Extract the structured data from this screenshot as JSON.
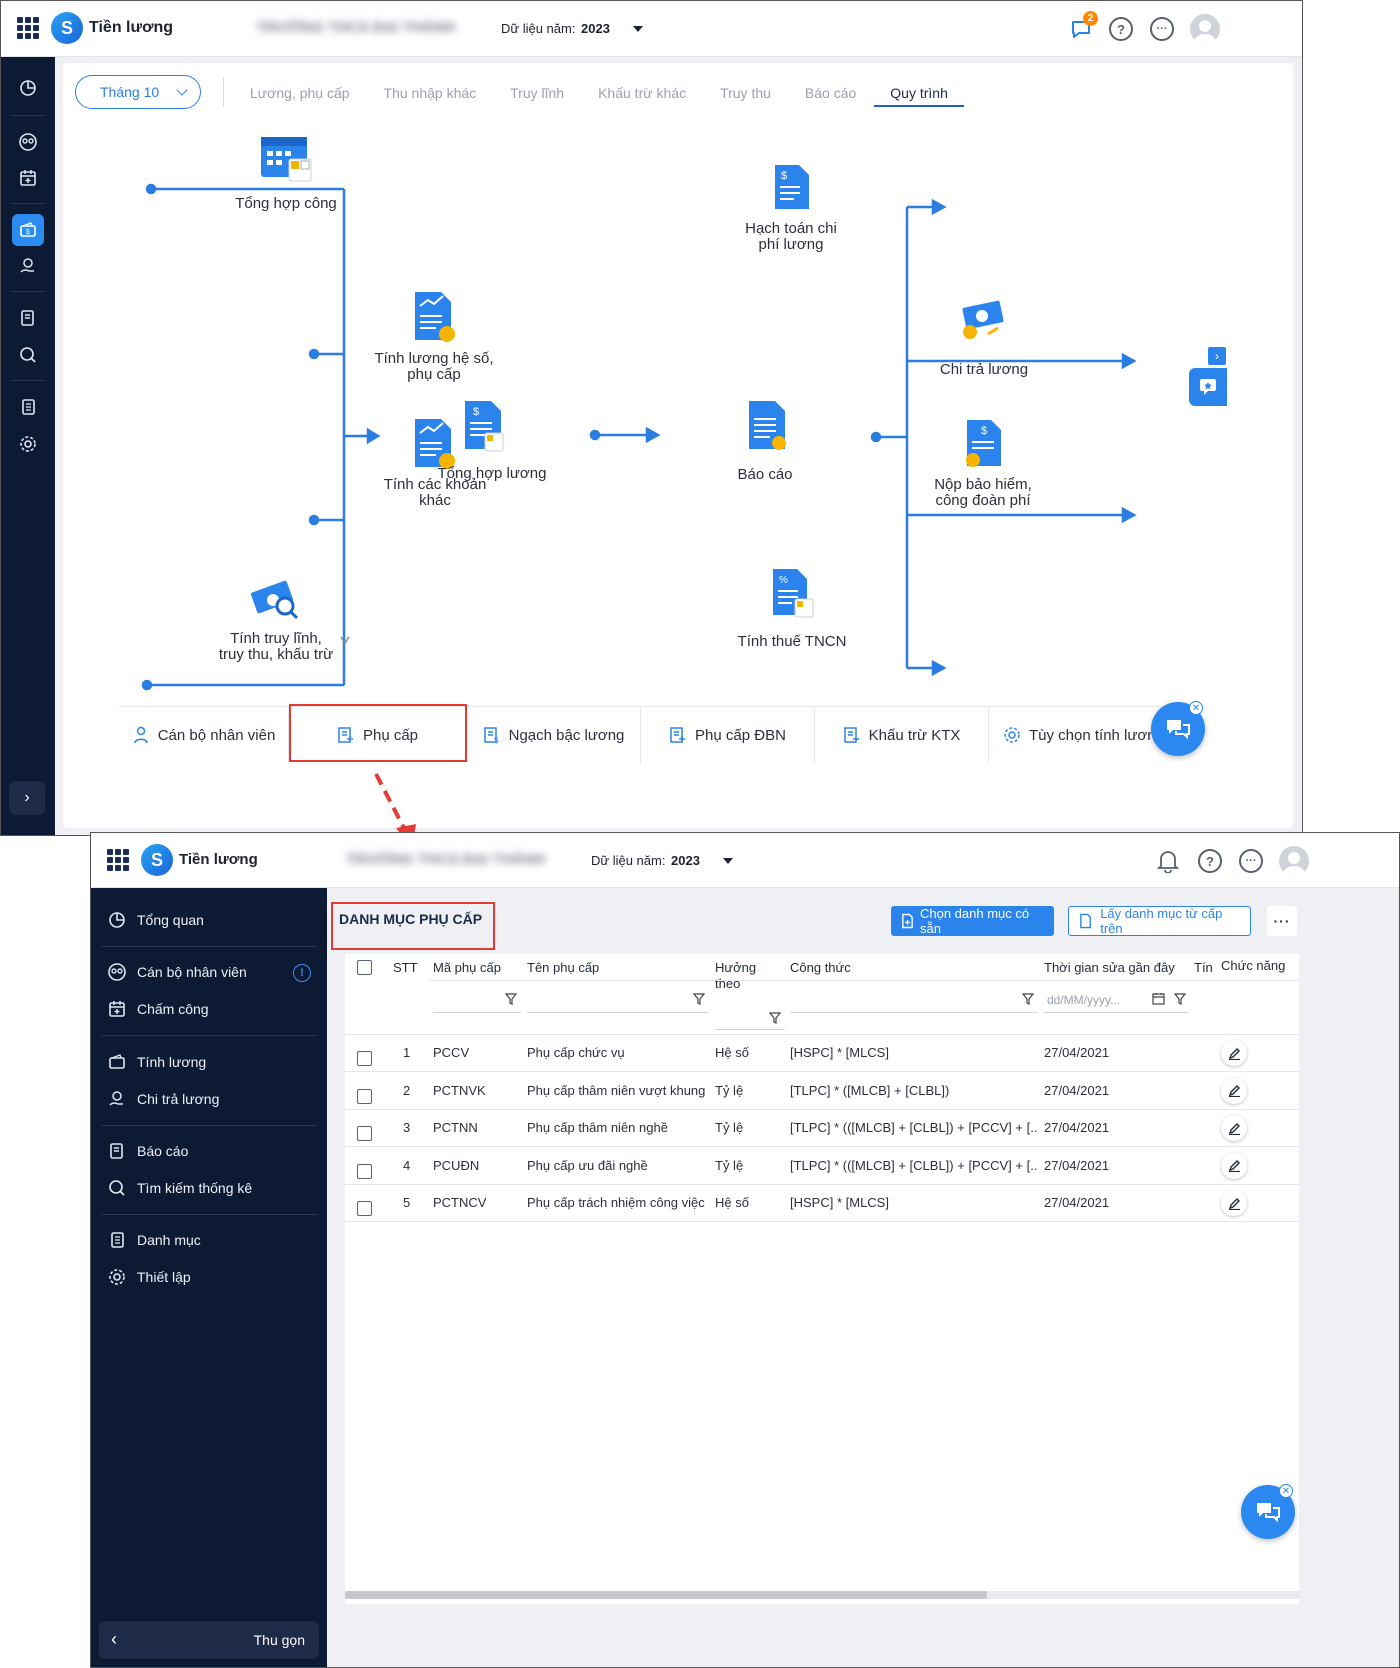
{
  "app": {
    "name": "Tiền lương",
    "org_name_blurred": "TRƯỜNG THCS ĐẠI THÀNH",
    "year_label": "Dữ liệu năm:",
    "year_value": "2023",
    "notification_count": "2"
  },
  "workflow": {
    "month_selector": "Tháng 10",
    "tabs": [
      "Lương, phụ cấp",
      "Thu nhập khác",
      "Truy lĩnh",
      "Khấu trừ khác",
      "Truy thu",
      "Báo cáo",
      "Quy trình"
    ],
    "active_tab": "Quy trình",
    "nodes": {
      "tong_hop_cong": "Tổng hợp công",
      "tinh_luong_he_so_1": "Tính lương hệ số,",
      "tinh_luong_he_so_2": "phụ cấp",
      "tinh_cac_khoan_1": "Tính các khoản",
      "tinh_cac_khoan_2": "khác",
      "tong_hop_luong": "Tổng hợp lương",
      "tinh_truy_linh_1": "Tính truy lĩnh,",
      "tinh_truy_linh_2": "truy thu, khấu trừ",
      "bao_cao": "Báo cáo",
      "hach_toan_1": "Hạch toán chi",
      "hach_toan_2": "phí lương",
      "chi_tra_luong": "Chi trả lương",
      "nop_bao_hiem_1": "Nộp bảo hiểm,",
      "nop_bao_hiem_2": "công đoàn phí",
      "tinh_thue": "Tính thuế TNCN"
    },
    "shortcuts": [
      "Cán bộ nhân viên",
      "Phụ cấp",
      "Ngạch bậc lương",
      "Phụ cấp ĐBN",
      "Khấu trừ KTX",
      "Tùy chọn tính lương"
    ]
  },
  "catalog": {
    "sidebar": {
      "items": [
        "Tổng quan",
        "Cán bộ nhân viên",
        "Chấm công",
        "Tính lương",
        "Chi trả lương",
        "Báo cáo",
        "Tìm kiếm thống kê",
        "Danh mục",
        "Thiết lập"
      ],
      "collapse": "Thu gọn"
    },
    "title": "DANH MỤC PHỤ CẤP",
    "btn_choose": "Chọn danh mục có sẵn",
    "btn_fetch": "Lấy danh mục từ cấp trên",
    "columns": {
      "stt": "STT",
      "code": "Mã phụ cấp",
      "name": "Tên phụ cấp",
      "basis": "Hưởng theo",
      "formula": "Công thức",
      "modified": "Thời gian sửa gần đây",
      "extra": "Tín",
      "actions": "Chức năng"
    },
    "date_placeholder": "dd/MM/yyyy...",
    "rows": [
      {
        "stt": "1",
        "code": "PCCV",
        "name": "Phụ cấp chức vụ",
        "basis": "Hệ số",
        "formula": "[HSPC] * [MLCS]",
        "modified": "27/04/2021"
      },
      {
        "stt": "2",
        "code": "PCTNVK",
        "name": "Phụ cấp thâm niên vượt khung",
        "basis": "Tỷ lệ",
        "formula": "[TLPC] * ([MLCB] + [CLBL])",
        "modified": "27/04/2021"
      },
      {
        "stt": "3",
        "code": "PCTNN",
        "name": "Phụ cấp thâm niên nghề",
        "basis": "Tỷ lệ",
        "formula": "[TLPC] * (([MLCB] + [CLBL]) + [PCCV] + [...",
        "modified": "27/04/2021"
      },
      {
        "stt": "4",
        "code": "PCUĐN",
        "name": "Phụ cấp ưu đãi nghề",
        "basis": "Tỷ lệ",
        "formula": "[TLPC] * (([MLCB] + [CLBL]) + [PCCV] + [...",
        "modified": "27/04/2021"
      },
      {
        "stt": "5",
        "code": "PCTNCV",
        "name": "Phụ cấp trách nhiệm công việc",
        "basis": "Hệ số",
        "formula": "[HSPC] * [MLCS]",
        "modified": "27/04/2021"
      }
    ]
  },
  "colors": {
    "primary": "#2a84ec",
    "sidebar": "#0d1a33",
    "highlight": "#e53935",
    "flow": "#2a7de1"
  }
}
